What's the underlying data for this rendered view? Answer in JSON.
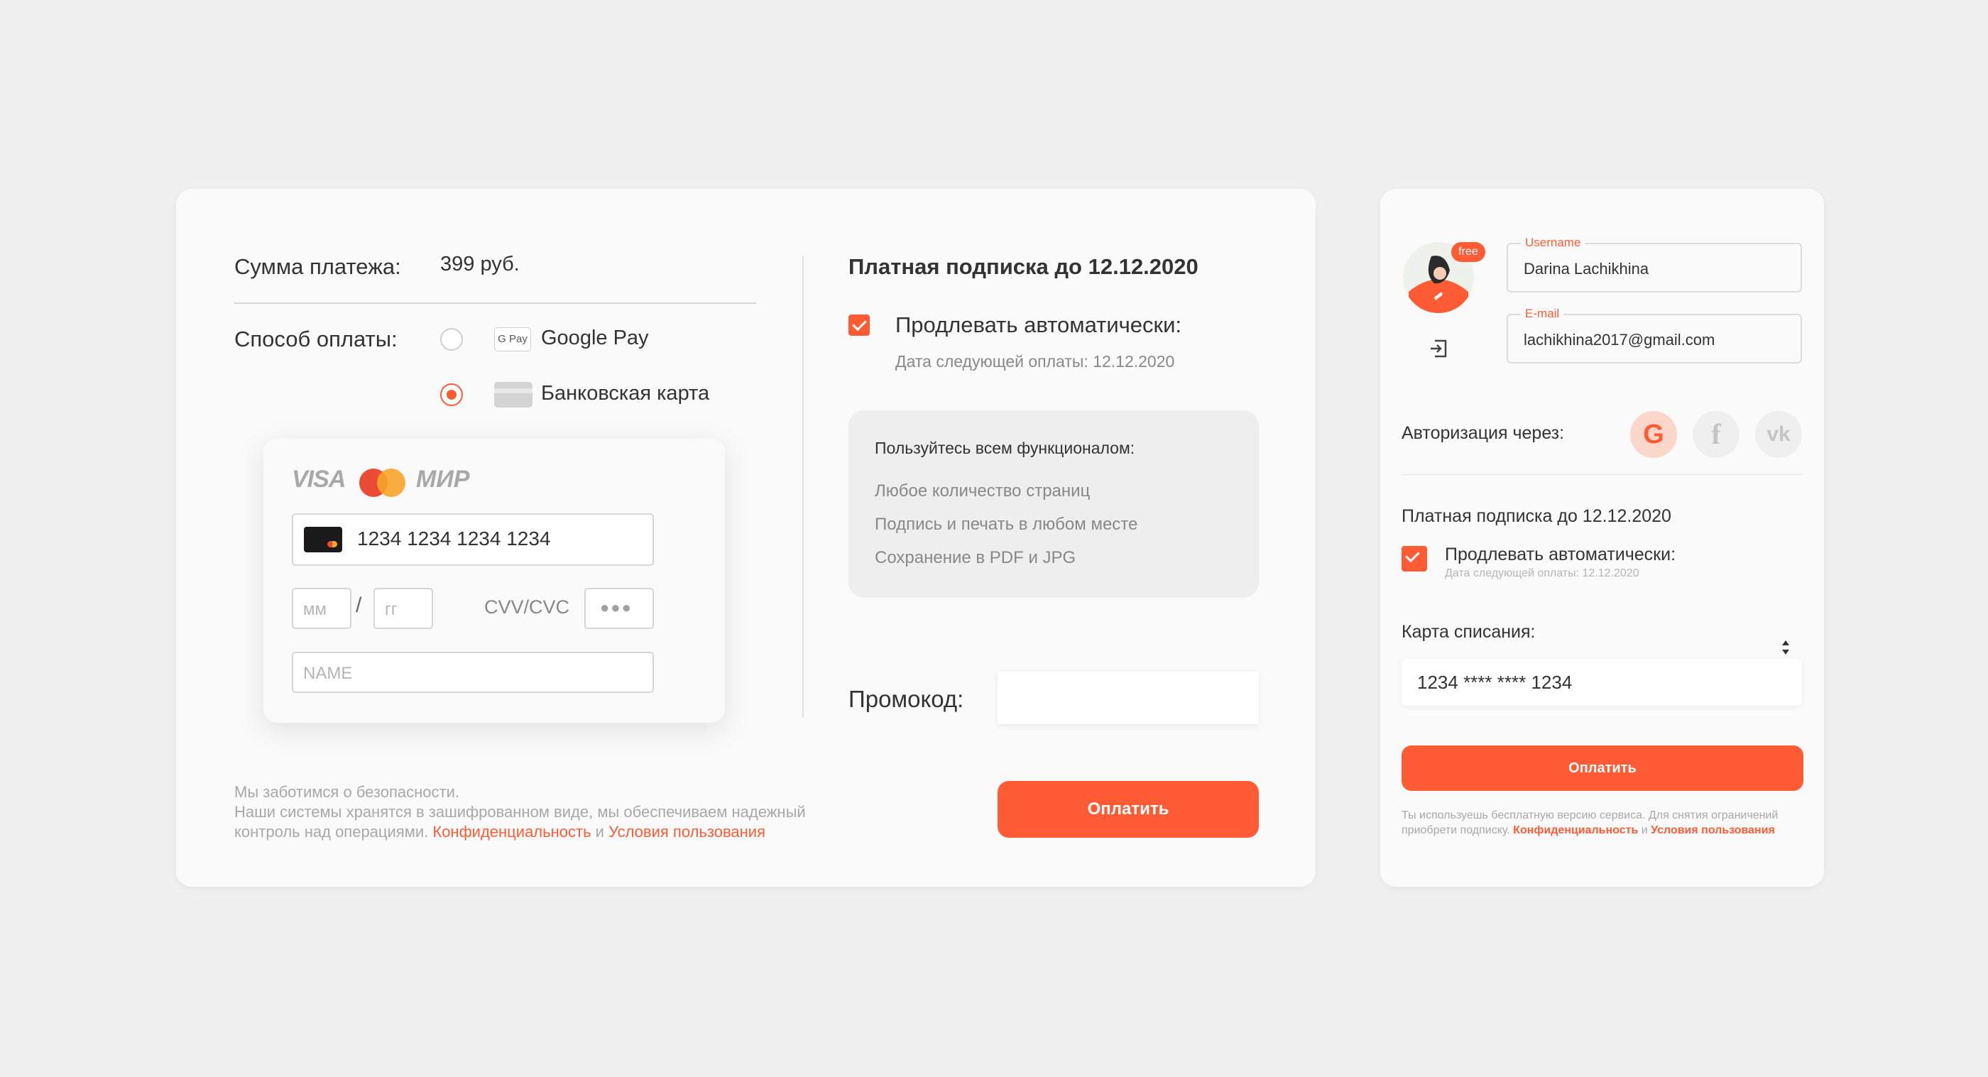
{
  "main": {
    "payment_sum_label": "Сумма платежа:",
    "payment_sum_value": "399 руб.",
    "payment_method_label": "Способ оплаты:",
    "options": [
      {
        "label": "Google Pay",
        "badge": "G Pay",
        "selected": false
      },
      {
        "label": "Банковская карта",
        "selected": true
      }
    ],
    "card_form": {
      "logos": {
        "visa": "VISA",
        "mir": "МИР"
      },
      "card_number": "1234 1234 1234 1234",
      "month_placeholder": "мм",
      "year_placeholder": "гг",
      "separator": "/",
      "cvv_label": "CVV/CVC",
      "cvv_value": "●●●",
      "name_placeholder": "NAME"
    },
    "security": {
      "title": "Мы заботимся о безопасности.",
      "text": "Наши системы хранятся в зашифрованном виде, мы обеспечиваем надежный",
      "text2": "контроль над операциями.",
      "privacy_link": "Конфиденциальность",
      "and": "и",
      "terms_link": "Условия пользования"
    },
    "subscription_title": "Платная подписка до 12.12.2020",
    "auto_renew_label": "Продлевать автоматически:",
    "next_payment": "Дата следующей оплаты: 12.12.2020",
    "features": {
      "title": "Пользуйтесь всем функционалом:",
      "items": [
        "Любое количество страниц",
        "Подпись и печать в любом месте",
        "Сохранение в PDF и JPG"
      ]
    },
    "promo_label": "Промокод:",
    "promo_value": "",
    "pay_button": "Оплатить"
  },
  "side": {
    "badge": "free",
    "username_label": "Username",
    "username_value": "Darina Lachikhina",
    "email_label": "E-mail",
    "email_value": "lachikhina2017@gmail.com",
    "auth_label": "Авторизация через:",
    "social": {
      "google": "G",
      "facebook": "f",
      "vk": "vk"
    },
    "subscription_title": "Платная подписка до 12.12.2020",
    "auto_renew_label": "Продлевать автоматически:",
    "next_payment": "Дата следующей оплаты: 12.12.2020",
    "card_label": "Карта списания:",
    "card_value": "1234 **** **** 1234",
    "pay_button": "Оплатить",
    "footer_text": "Ты используешь бесплатную версию сервиса. Для снятия ограничений",
    "footer_text2": "приобрети подписку.",
    "privacy_link": "Конфиденциальность",
    "and": "и",
    "terms_link": "Условия пользования"
  },
  "colors": {
    "accent": "#ff5c35",
    "background": "#f0f0f0",
    "panel": "#fafafa"
  }
}
